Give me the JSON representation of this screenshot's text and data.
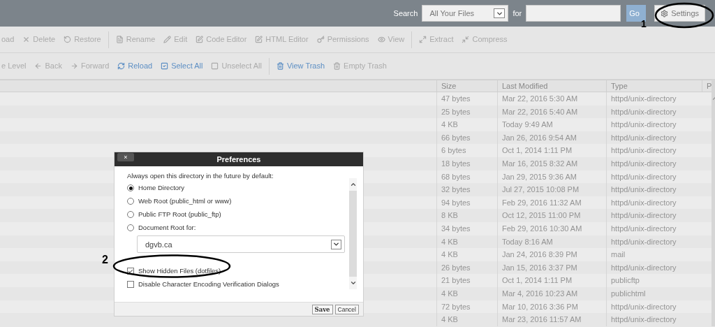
{
  "top_bar": {
    "search_label": "Search",
    "scope": "All Your Files",
    "for_label": "for",
    "go": "Go",
    "settings": "Settings"
  },
  "toolbar": [
    {
      "label": "oad",
      "disabled": true
    },
    {
      "label": "Delete",
      "disabled": true
    },
    {
      "label": "Restore",
      "disabled": true
    },
    {
      "kind": "sep"
    },
    {
      "label": "Rename",
      "disabled": true
    },
    {
      "label": "Edit",
      "disabled": true
    },
    {
      "label": "Code Editor",
      "disabled": true
    },
    {
      "label": "HTML Editor",
      "disabled": true
    },
    {
      "label": "Permissions",
      "disabled": true
    },
    {
      "label": "View",
      "disabled": true
    },
    {
      "kind": "sep"
    },
    {
      "label": "Extract",
      "disabled": true
    },
    {
      "label": "Compress",
      "disabled": true
    }
  ],
  "nav_bar": [
    {
      "label": "e Level",
      "disabled": true
    },
    {
      "label": "Back",
      "disabled": true
    },
    {
      "label": "Forward",
      "disabled": true
    },
    {
      "label": "Reload",
      "disabled": false
    },
    {
      "label": "Select All",
      "disabled": false
    },
    {
      "label": "Unselect All",
      "disabled": true
    },
    {
      "kind": "sep"
    },
    {
      "label": "View Trash",
      "disabled": false
    },
    {
      "label": "Empty Trash",
      "disabled": true
    }
  ],
  "table": {
    "columns": [
      "Size",
      "Last Modified",
      "Type",
      "P"
    ],
    "rows": [
      [
        "47 bytes",
        "Mar 22, 2016 5:30 AM",
        "httpd/unix-directory"
      ],
      [
        "25 bytes",
        "Mar 22, 2016 5:40 AM",
        "httpd/unix-directory"
      ],
      [
        "4 KB",
        "Today 9:49 AM",
        "httpd/unix-directory"
      ],
      [
        "66 bytes",
        "Jan 26, 2016 9:54 AM",
        "httpd/unix-directory"
      ],
      [
        "6 bytes",
        "Oct 1, 2014 1:11 PM",
        "httpd/unix-directory"
      ],
      [
        "18 bytes",
        "Mar 16, 2015 8:32 AM",
        "httpd/unix-directory"
      ],
      [
        "68 bytes",
        "Jan 29, 2015 9:36 AM",
        "httpd/unix-directory"
      ],
      [
        "32 bytes",
        "Jul 27, 2015 10:08 PM",
        "httpd/unix-directory"
      ],
      [
        "94 bytes",
        "Feb 29, 2016 11:32 AM",
        "httpd/unix-directory"
      ],
      [
        "8 KB",
        "Oct 12, 2015 11:00 PM",
        "httpd/unix-directory"
      ],
      [
        "34 bytes",
        "Feb 29, 2016 10:30 AM",
        "httpd/unix-directory"
      ],
      [
        "4 KB",
        "Today 8:16 AM",
        "httpd/unix-directory"
      ],
      [
        "4 KB",
        "Jan 24, 2016 8:39 PM",
        "mail"
      ],
      [
        "26 bytes",
        "Jan 15, 2016 3:37 PM",
        "httpd/unix-directory"
      ],
      [
        "21 bytes",
        "Oct 1, 2014 1:11 PM",
        "publicftp"
      ],
      [
        "4 KB",
        "Mar 4, 2016 10:23 AM",
        "publichtml"
      ],
      [
        "72 bytes",
        "Mar 10, 2016 3:36 PM",
        "httpd/unix-directory"
      ],
      [
        "4 KB",
        "Mar 23, 2016 11:57 AM",
        "httpd/unix-directory"
      ]
    ]
  },
  "dialog": {
    "title": "Preferences",
    "close": "×",
    "intro": "Always open this directory in the future by default:",
    "options": [
      {
        "label": "Home Directory",
        "selected": true
      },
      {
        "label": "Web Root (public_html or www)",
        "selected": false
      },
      {
        "label": "Public FTP Root (public_ftp)",
        "selected": false
      },
      {
        "label": "Document Root for:",
        "selected": false
      }
    ],
    "domain": "dgvb.ca",
    "checkboxes": [
      {
        "label": "Show Hidden Files (dotfiles)",
        "checked": true
      },
      {
        "label": "Disable Character Encoding Verification Dialogs",
        "checked": false
      }
    ],
    "buttons": [
      "Save",
      "Cancel"
    ]
  },
  "annotations": [
    "1",
    "2"
  ]
}
